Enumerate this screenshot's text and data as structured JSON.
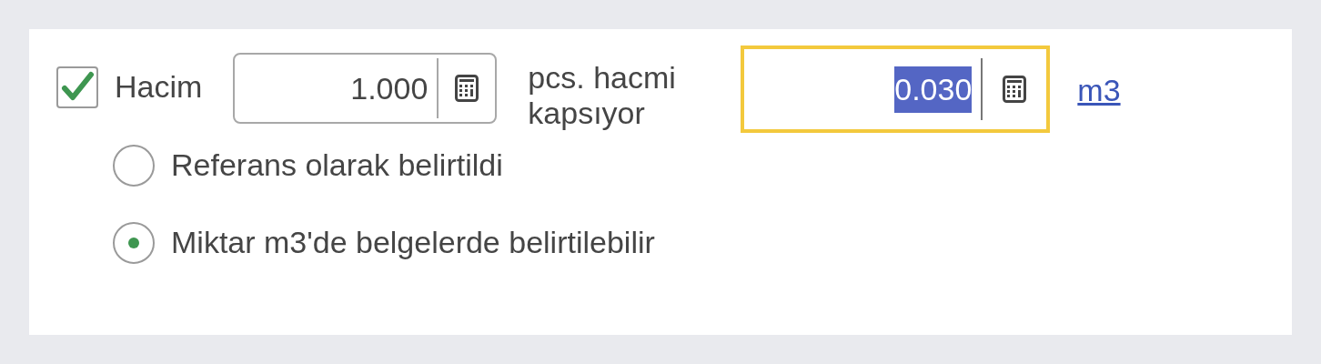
{
  "volume": {
    "checkbox": {
      "label": "Hacim",
      "checked": true
    },
    "quantity_field": {
      "value": "1.000",
      "focused": false,
      "text_selected": false
    },
    "middle_label": "pcs. hacmi kapsıyor",
    "volume_field": {
      "value": "0.030",
      "focused": true,
      "text_selected": true
    },
    "unit_link": "m3"
  },
  "options": [
    {
      "label": "Referans olarak belirtildi",
      "selected": false
    },
    {
      "label": "Miktar m3'de belgelerde belirtilebilir",
      "selected": true
    }
  ]
}
